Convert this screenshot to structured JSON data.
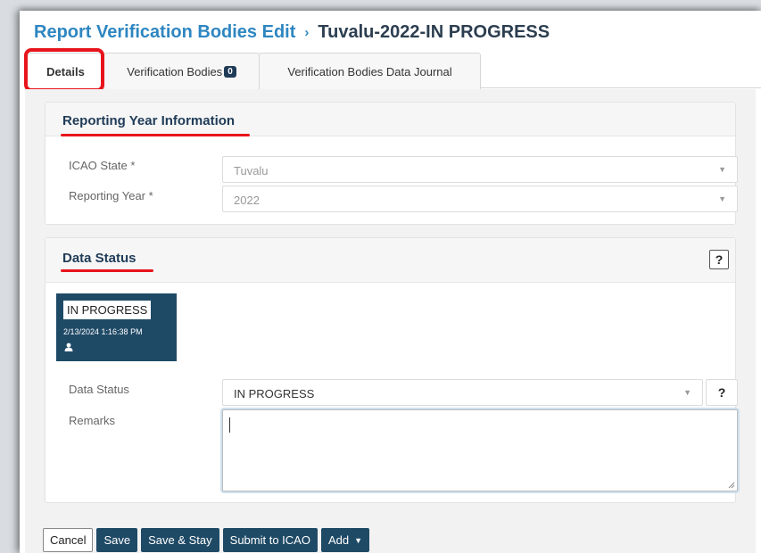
{
  "header": {
    "breadcrumb_link": "Report Verification Bodies Edit",
    "separator": "›",
    "current": "Tuvalu-2022-IN PROGRESS"
  },
  "tabs": [
    {
      "label": "Details",
      "active": true
    },
    {
      "label": "Verification Bodies",
      "badge": "0"
    },
    {
      "label": "Verification Bodies Data Journal"
    }
  ],
  "reporting_year": {
    "title": "Reporting Year Information",
    "icao_state_label": "ICAO State *",
    "icao_state_value": "Tuvalu",
    "year_label": "Reporting Year *",
    "year_value": "2022"
  },
  "data_status": {
    "title": "Data Status",
    "help": "?",
    "card_status": "IN PROGRESS",
    "card_timestamp": "2/13/2024 1:16:38 PM",
    "field_label": "Data Status",
    "field_value": "IN PROGRESS",
    "remarks_label": "Remarks",
    "remarks_value": ""
  },
  "actions": {
    "cancel": "Cancel",
    "save": "Save",
    "save_stay": "Save & Stay",
    "submit": "Submit to ICAO",
    "add": "Add"
  },
  "colors": {
    "accent": "#2e86c1",
    "navy": "#1f4a66",
    "highlight": "#e8141c"
  }
}
